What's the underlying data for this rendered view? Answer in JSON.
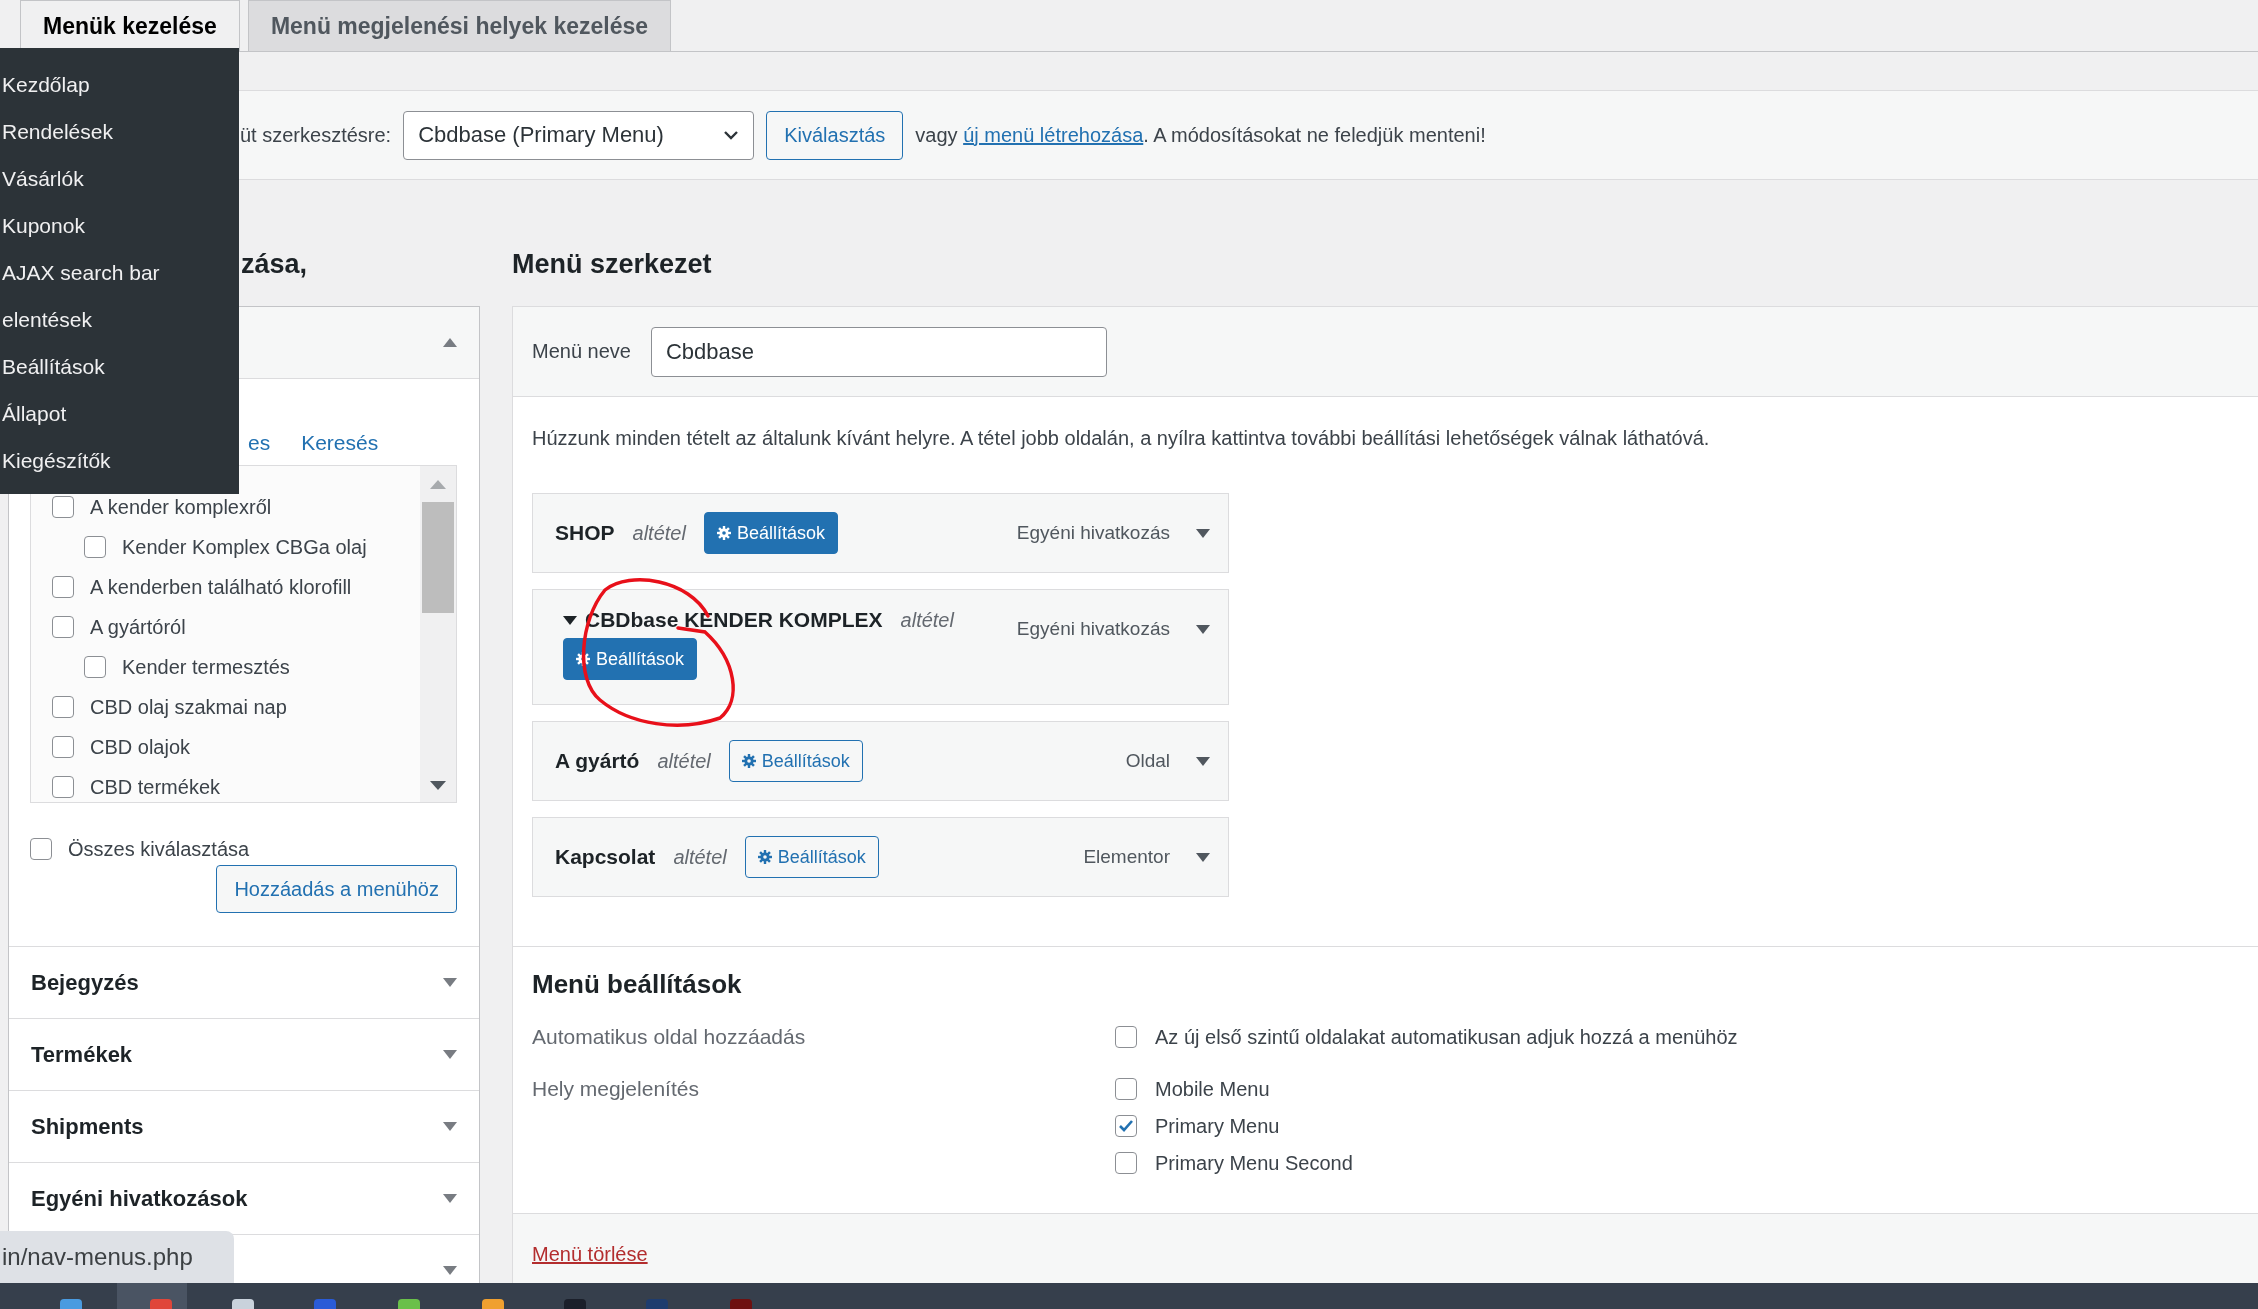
{
  "tabs": [
    {
      "label": "Menük kezelése",
      "selected": true
    },
    {
      "label": "Menü megjelenési helyek kezelése",
      "selected": false
    }
  ],
  "admin_menu": {
    "items": [
      "Kezdőlap",
      "Rendelések",
      "Vásárlók",
      "Kuponok",
      "AJAX search bar",
      "elentések",
      "Beállítások",
      "Állapot",
      "Kiegészítők"
    ]
  },
  "menu_select": {
    "label": "üt szerkesztésre:",
    "value": "Cbdbase (Primary Menu)",
    "button": "Kiválasztás",
    "text_before": "vagy ",
    "link": "új menü létrehozása",
    "text_after": ". A módosításokat ne feledjük menteni!"
  },
  "left_column": {
    "heading": "zása,",
    "panel": {
      "expanded": true,
      "tabs": [
        {
          "label": "es",
          "selected": false
        },
        {
          "label": "Keresés",
          "selected": false
        }
      ],
      "pages": [
        {
          "label": "A kender komplexről",
          "checked": false,
          "children": [
            {
              "label": "Kender Komplex CBGa olaj",
              "checked": false
            }
          ]
        },
        {
          "label": "A kenderben található klorofill",
          "checked": false
        },
        {
          "label": "A gyártóról",
          "checked": false,
          "children": [
            {
              "label": "Kender termesztés",
              "checked": false
            }
          ]
        },
        {
          "label": "CBD olaj szakmai nap",
          "checked": false
        },
        {
          "label": "CBD olajok",
          "checked": false
        },
        {
          "label": "CBD termékek",
          "checked": false
        }
      ],
      "select_all": {
        "label": "Összes kiválasztása",
        "checked": false
      },
      "add_button": "Hozzáadás a menühöz"
    },
    "sections": [
      {
        "title": "Bejegyzés",
        "expanded": false
      },
      {
        "title": "Termékek",
        "expanded": false
      },
      {
        "title": "Shipments",
        "expanded": false
      },
      {
        "title": "Egyéni hivatkozások",
        "expanded": false
      },
      {
        "expanded": false
      }
    ]
  },
  "menu_structure": {
    "heading": "Menü szerkezet",
    "name_label": "Menü neve",
    "name_value": "Cbdbase",
    "instructions": "Húzzunk minden tételt az általunk kívánt helyre. A tétel jobb oldalán, a nyílra kattintva további beállítási lehetőségek válnak láthatóvá.",
    "items": [
      {
        "title": "SHOP",
        "subtitle": "altétel",
        "button": "Beállítások",
        "button_primary": true,
        "child_toggle": false,
        "type": "Egyéni hivatkozás"
      },
      {
        "title": "CBDbase KENDER KOMPLEX",
        "subtitle": "altétel",
        "button": "Beállítások",
        "button_primary": true,
        "child_toggle": true,
        "type": "Egyéni hivatkozás"
      },
      {
        "title": "A gyártó",
        "subtitle": "altétel",
        "button": "Beállítások",
        "button_primary": false,
        "child_toggle": false,
        "type": "Oldal"
      },
      {
        "title": "Kapcsolat",
        "subtitle": "altétel",
        "button": "Beállítások",
        "button_primary": false,
        "child_toggle": false,
        "type": "Elementor"
      }
    ]
  },
  "menu_settings": {
    "heading": "Menü beállítások",
    "rows": [
      {
        "label": "Automatikus oldal hozzáadás",
        "options": [
          {
            "label": "Az új első szintű oldalakat automatikusan adjuk hozzá a menühöz",
            "checked": false
          }
        ]
      },
      {
        "label": "Hely megjelenítés",
        "options": [
          {
            "label": "Mobile Menu",
            "checked": false
          },
          {
            "label": "Primary Menu",
            "checked": true
          },
          {
            "label": "Primary Menu Second",
            "checked": false
          }
        ]
      }
    ],
    "delete_link": "Menü törlése"
  },
  "status_tooltip": "in/nav-menus.php"
}
